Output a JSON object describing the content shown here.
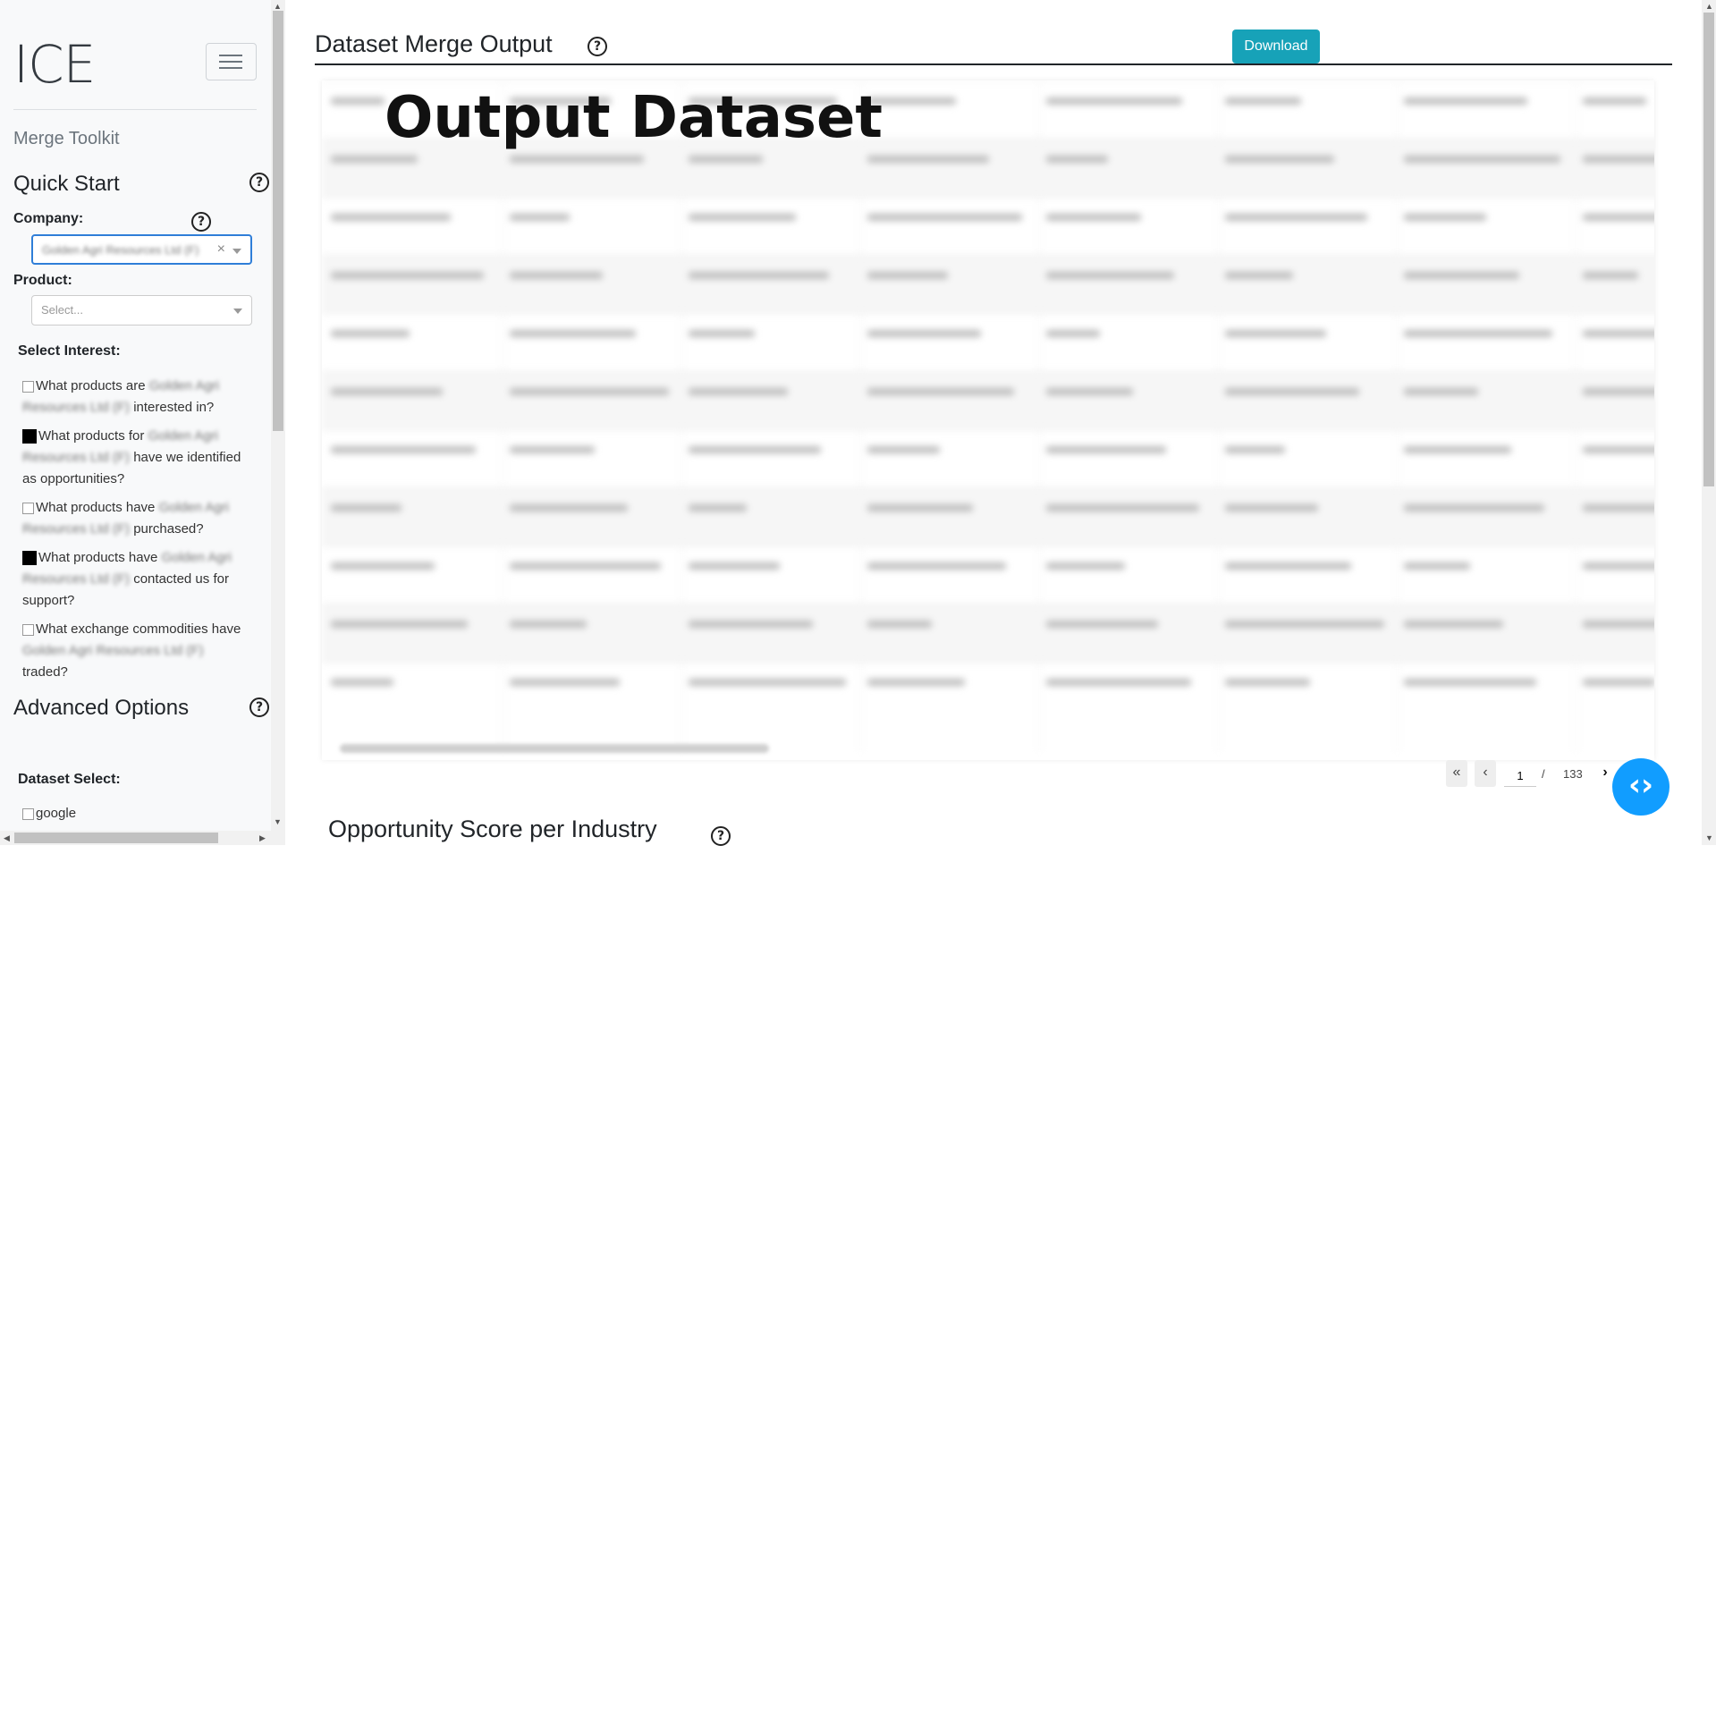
{
  "sidebar": {
    "brand": "ICE",
    "subtitle": "Merge Toolkit",
    "quick_start_title": "Quick Start",
    "company_label": "Company:",
    "company_value": "Golden Agri Resources Ltd (F)",
    "product_label": "Product:",
    "product_placeholder": "Select...",
    "select_interest_label": "Select Interest:",
    "interests": [
      {
        "pre": "What products are ",
        "company": "Golden Agri Resources Ltd (F)",
        "post": " interested in?",
        "checked": false
      },
      {
        "pre": "What products for ",
        "company": "Golden Agri Resources Ltd (F)",
        "post": " have we identified as opportunities?",
        "checked": true
      },
      {
        "pre": "What products have ",
        "company": "Golden Agri Resources Ltd (F)",
        "post": " purchased?",
        "checked": false
      },
      {
        "pre": "What products have ",
        "company": "Golden Agri Resources Ltd (F)",
        "post": " contacted us for support?",
        "checked": true
      },
      {
        "pre": "What exchange commodities have ",
        "company": "Golden Agri Resources Ltd (F)",
        "post": " traded?",
        "checked": false
      }
    ],
    "advanced_title": "Advanced Options",
    "dataset_select_label": "Dataset Select:",
    "dataset_option": "google"
  },
  "main": {
    "title": "Dataset Merge Output",
    "download_label": "Download",
    "overlay_title": "Output Dataset",
    "pager": {
      "current": "1",
      "separator": "/",
      "total": "133"
    },
    "section2_title": "Opportunity Score per Industry"
  },
  "colors": {
    "accent": "#17a2b8",
    "fab": "#119dff",
    "focus": "#2f7ed8"
  }
}
